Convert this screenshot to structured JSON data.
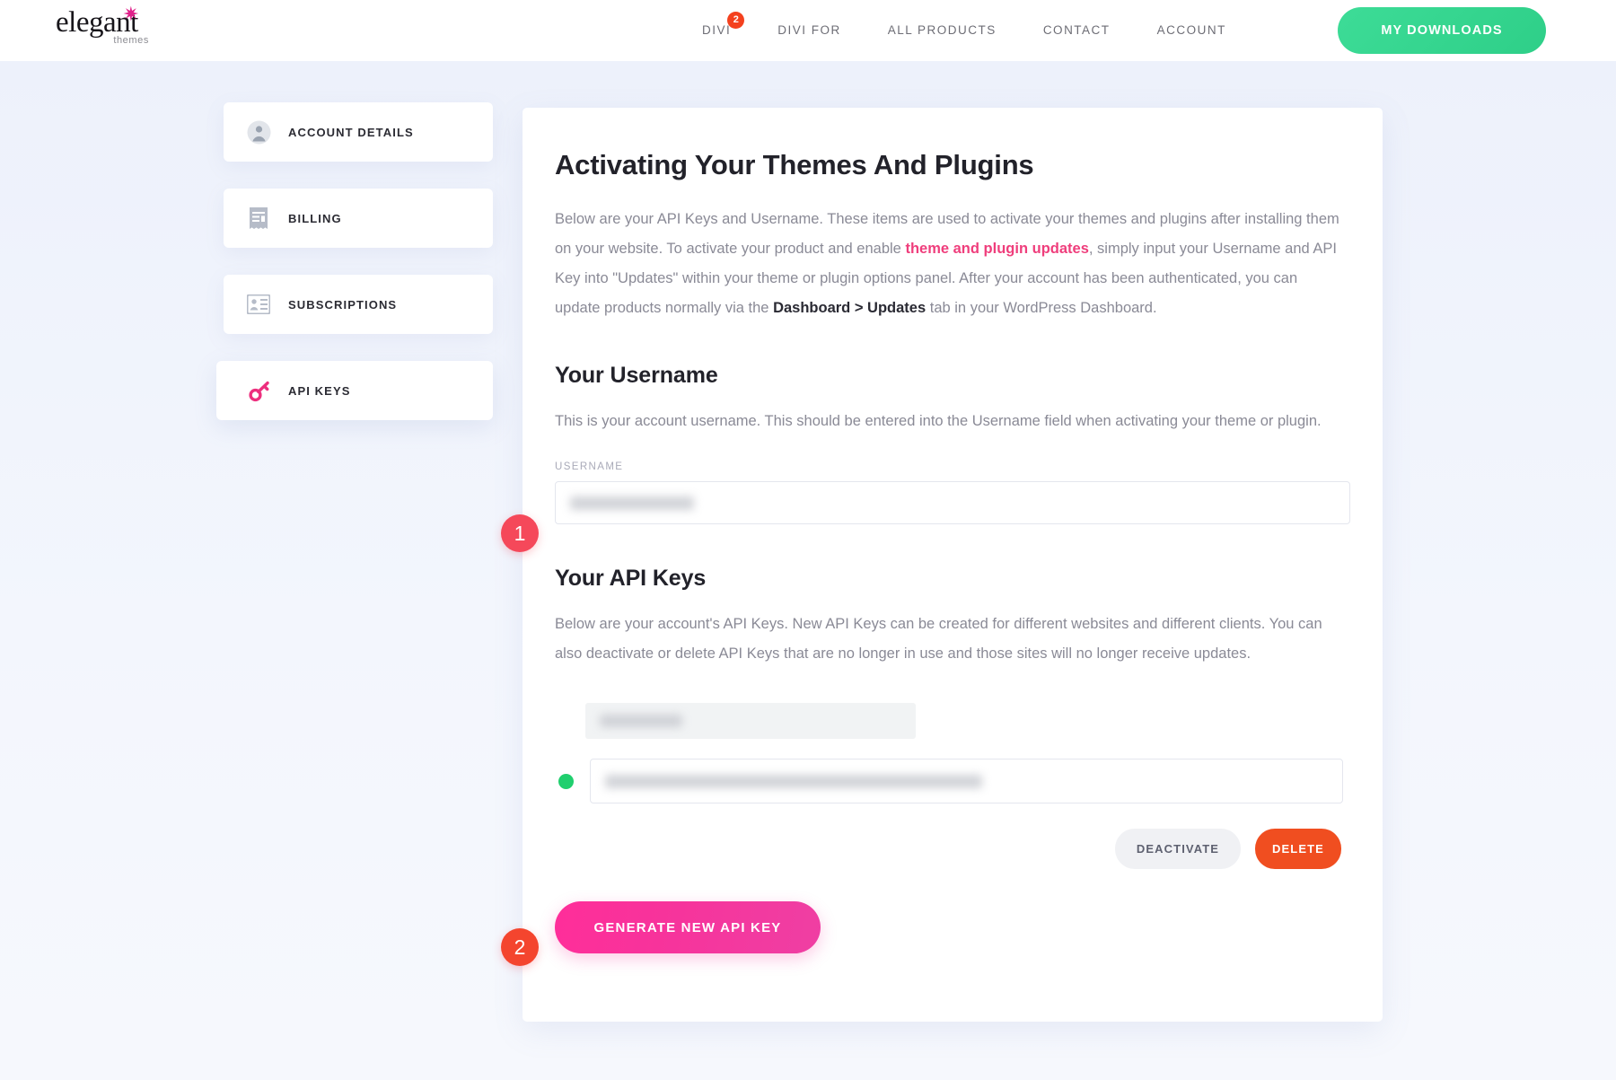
{
  "header": {
    "logo": {
      "word": "elegant",
      "sub": "themes",
      "star": "✷"
    },
    "nav": [
      {
        "label": "DIVI",
        "badge": "2"
      },
      {
        "label": "DIVI FOR",
        "badge": null
      },
      {
        "label": "ALL PRODUCTS",
        "badge": null
      },
      {
        "label": "CONTACT",
        "badge": null
      },
      {
        "label": "ACCOUNT",
        "badge": null
      }
    ],
    "downloads_button": "MY DOWNLOADS"
  },
  "sidebar": {
    "items": [
      {
        "label": "ACCOUNT DETAILS",
        "icon": "user-avatar-icon",
        "active": false
      },
      {
        "label": "BILLING",
        "icon": "receipt-icon",
        "active": false
      },
      {
        "label": "SUBSCRIPTIONS",
        "icon": "id-card-icon",
        "active": false
      },
      {
        "label": "API KEYS",
        "icon": "key-icon",
        "active": true
      }
    ]
  },
  "main": {
    "title": "Activating Your Themes And Plugins",
    "intro": {
      "part1": "Below are your API Keys and Username. These items are used to activate your themes and plugins after installing them on your website. To activate your product and enable ",
      "link": "theme and plugin updates",
      "part2": ", simply input your Username and API Key into \"Updates\" within your theme or plugin options panel. After your account has been authenticated, you can update products normally via the ",
      "bold": "Dashboard > Updates",
      "part3": " tab in your WordPress Dashboard."
    },
    "username_section": {
      "heading": "Your Username",
      "description": "This is your account username. This should be entered into the Username field when activating your theme or plugin.",
      "field_label": "USERNAME",
      "field_value": "",
      "field_placeholder": ""
    },
    "apikeys_section": {
      "heading": "Your API Keys",
      "description": "Below are your account's API Keys. New API Keys can be created for different websites and different clients. You can also deactivate or delete API Keys that are no longer in use and those sites will no longer receive updates.",
      "key_row": {
        "status": "active",
        "status_color": "#20cf6e",
        "name_value": "",
        "key_value": ""
      },
      "deactivate_label": "DEACTIVATE",
      "delete_label": "DELETE",
      "generate_label": "GENERATE NEW API KEY"
    }
  },
  "annotations": {
    "steps": [
      {
        "number": "1",
        "color": "#f5485a"
      },
      {
        "number": "2",
        "color": "#f4452e"
      }
    ]
  },
  "colors": {
    "page_bg": "#eef2fb",
    "accent_pink": "#ef3e7c",
    "accent_green": "#2ecf88",
    "delete_orange": "#f04e20",
    "generate_pink": "#f7339b"
  }
}
